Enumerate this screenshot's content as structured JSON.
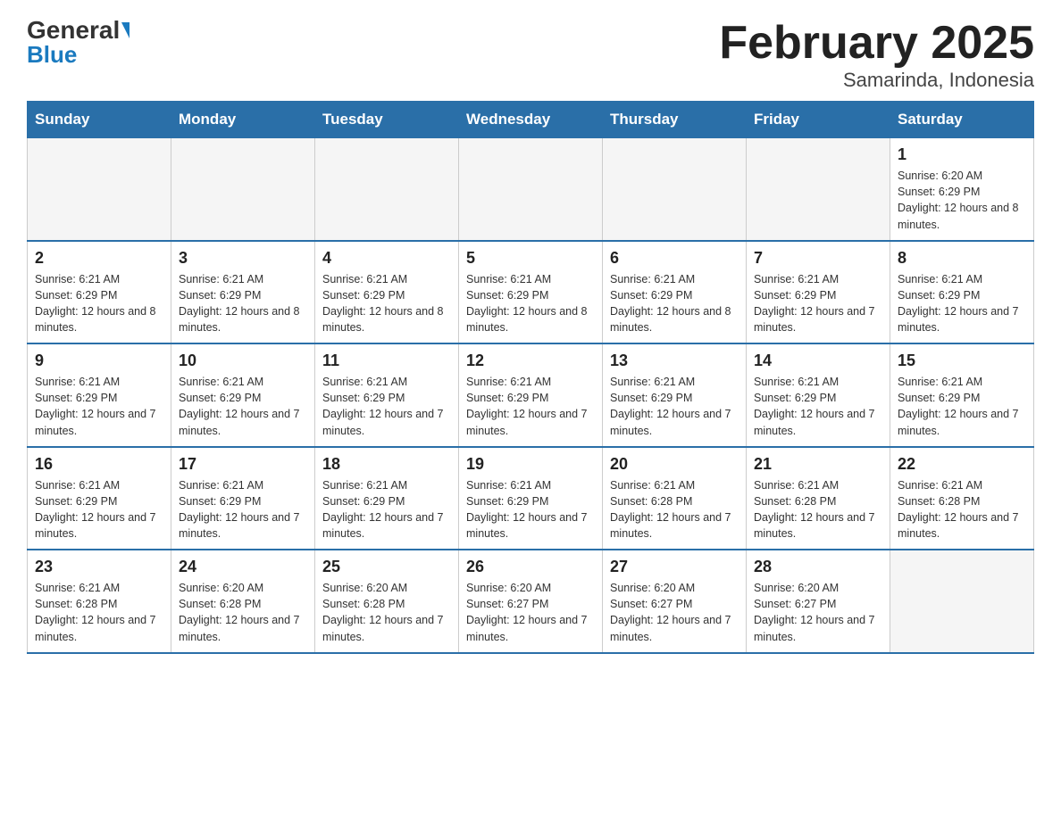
{
  "header": {
    "logo_general": "General",
    "logo_blue": "Blue",
    "title": "February 2025",
    "subtitle": "Samarinda, Indonesia"
  },
  "days_of_week": [
    "Sunday",
    "Monday",
    "Tuesday",
    "Wednesday",
    "Thursday",
    "Friday",
    "Saturday"
  ],
  "weeks": [
    [
      {
        "day": "",
        "info": ""
      },
      {
        "day": "",
        "info": ""
      },
      {
        "day": "",
        "info": ""
      },
      {
        "day": "",
        "info": ""
      },
      {
        "day": "",
        "info": ""
      },
      {
        "day": "",
        "info": ""
      },
      {
        "day": "1",
        "info": "Sunrise: 6:20 AM\nSunset: 6:29 PM\nDaylight: 12 hours and 8 minutes."
      }
    ],
    [
      {
        "day": "2",
        "info": "Sunrise: 6:21 AM\nSunset: 6:29 PM\nDaylight: 12 hours and 8 minutes."
      },
      {
        "day": "3",
        "info": "Sunrise: 6:21 AM\nSunset: 6:29 PM\nDaylight: 12 hours and 8 minutes."
      },
      {
        "day": "4",
        "info": "Sunrise: 6:21 AM\nSunset: 6:29 PM\nDaylight: 12 hours and 8 minutes."
      },
      {
        "day": "5",
        "info": "Sunrise: 6:21 AM\nSunset: 6:29 PM\nDaylight: 12 hours and 8 minutes."
      },
      {
        "day": "6",
        "info": "Sunrise: 6:21 AM\nSunset: 6:29 PM\nDaylight: 12 hours and 8 minutes."
      },
      {
        "day": "7",
        "info": "Sunrise: 6:21 AM\nSunset: 6:29 PM\nDaylight: 12 hours and 7 minutes."
      },
      {
        "day": "8",
        "info": "Sunrise: 6:21 AM\nSunset: 6:29 PM\nDaylight: 12 hours and 7 minutes."
      }
    ],
    [
      {
        "day": "9",
        "info": "Sunrise: 6:21 AM\nSunset: 6:29 PM\nDaylight: 12 hours and 7 minutes."
      },
      {
        "day": "10",
        "info": "Sunrise: 6:21 AM\nSunset: 6:29 PM\nDaylight: 12 hours and 7 minutes."
      },
      {
        "day": "11",
        "info": "Sunrise: 6:21 AM\nSunset: 6:29 PM\nDaylight: 12 hours and 7 minutes."
      },
      {
        "day": "12",
        "info": "Sunrise: 6:21 AM\nSunset: 6:29 PM\nDaylight: 12 hours and 7 minutes."
      },
      {
        "day": "13",
        "info": "Sunrise: 6:21 AM\nSunset: 6:29 PM\nDaylight: 12 hours and 7 minutes."
      },
      {
        "day": "14",
        "info": "Sunrise: 6:21 AM\nSunset: 6:29 PM\nDaylight: 12 hours and 7 minutes."
      },
      {
        "day": "15",
        "info": "Sunrise: 6:21 AM\nSunset: 6:29 PM\nDaylight: 12 hours and 7 minutes."
      }
    ],
    [
      {
        "day": "16",
        "info": "Sunrise: 6:21 AM\nSunset: 6:29 PM\nDaylight: 12 hours and 7 minutes."
      },
      {
        "day": "17",
        "info": "Sunrise: 6:21 AM\nSunset: 6:29 PM\nDaylight: 12 hours and 7 minutes."
      },
      {
        "day": "18",
        "info": "Sunrise: 6:21 AM\nSunset: 6:29 PM\nDaylight: 12 hours and 7 minutes."
      },
      {
        "day": "19",
        "info": "Sunrise: 6:21 AM\nSunset: 6:29 PM\nDaylight: 12 hours and 7 minutes."
      },
      {
        "day": "20",
        "info": "Sunrise: 6:21 AM\nSunset: 6:28 PM\nDaylight: 12 hours and 7 minutes."
      },
      {
        "day": "21",
        "info": "Sunrise: 6:21 AM\nSunset: 6:28 PM\nDaylight: 12 hours and 7 minutes."
      },
      {
        "day": "22",
        "info": "Sunrise: 6:21 AM\nSunset: 6:28 PM\nDaylight: 12 hours and 7 minutes."
      }
    ],
    [
      {
        "day": "23",
        "info": "Sunrise: 6:21 AM\nSunset: 6:28 PM\nDaylight: 12 hours and 7 minutes."
      },
      {
        "day": "24",
        "info": "Sunrise: 6:20 AM\nSunset: 6:28 PM\nDaylight: 12 hours and 7 minutes."
      },
      {
        "day": "25",
        "info": "Sunrise: 6:20 AM\nSunset: 6:28 PM\nDaylight: 12 hours and 7 minutes."
      },
      {
        "day": "26",
        "info": "Sunrise: 6:20 AM\nSunset: 6:27 PM\nDaylight: 12 hours and 7 minutes."
      },
      {
        "day": "27",
        "info": "Sunrise: 6:20 AM\nSunset: 6:27 PM\nDaylight: 12 hours and 7 minutes."
      },
      {
        "day": "28",
        "info": "Sunrise: 6:20 AM\nSunset: 6:27 PM\nDaylight: 12 hours and 7 minutes."
      },
      {
        "day": "",
        "info": ""
      }
    ]
  ]
}
